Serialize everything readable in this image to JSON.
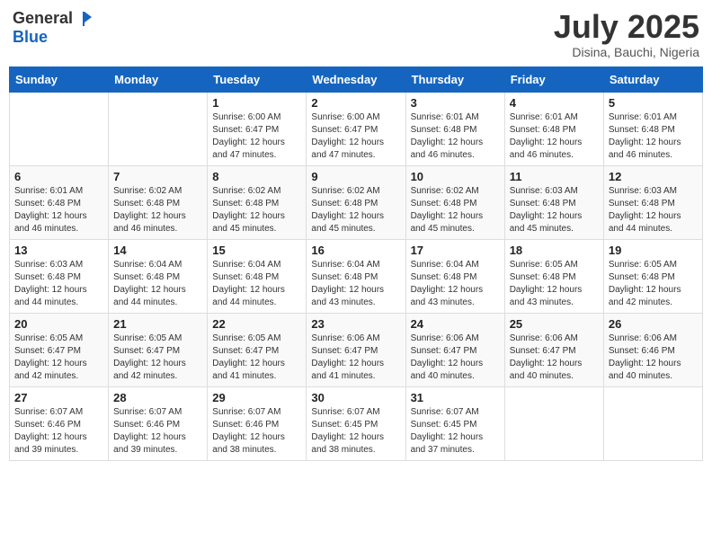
{
  "header": {
    "logo_general": "General",
    "logo_blue": "Blue",
    "month_title": "July 2025",
    "subtitle": "Disina, Bauchi, Nigeria"
  },
  "weekdays": [
    "Sunday",
    "Monday",
    "Tuesday",
    "Wednesday",
    "Thursday",
    "Friday",
    "Saturday"
  ],
  "weeks": [
    [
      {
        "day": "",
        "sunrise": "",
        "sunset": "",
        "daylight": ""
      },
      {
        "day": "",
        "sunrise": "",
        "sunset": "",
        "daylight": ""
      },
      {
        "day": "1",
        "sunrise": "Sunrise: 6:00 AM",
        "sunset": "Sunset: 6:47 PM",
        "daylight": "Daylight: 12 hours and 47 minutes."
      },
      {
        "day": "2",
        "sunrise": "Sunrise: 6:00 AM",
        "sunset": "Sunset: 6:47 PM",
        "daylight": "Daylight: 12 hours and 47 minutes."
      },
      {
        "day": "3",
        "sunrise": "Sunrise: 6:01 AM",
        "sunset": "Sunset: 6:48 PM",
        "daylight": "Daylight: 12 hours and 46 minutes."
      },
      {
        "day": "4",
        "sunrise": "Sunrise: 6:01 AM",
        "sunset": "Sunset: 6:48 PM",
        "daylight": "Daylight: 12 hours and 46 minutes."
      },
      {
        "day": "5",
        "sunrise": "Sunrise: 6:01 AM",
        "sunset": "Sunset: 6:48 PM",
        "daylight": "Daylight: 12 hours and 46 minutes."
      }
    ],
    [
      {
        "day": "6",
        "sunrise": "Sunrise: 6:01 AM",
        "sunset": "Sunset: 6:48 PM",
        "daylight": "Daylight: 12 hours and 46 minutes."
      },
      {
        "day": "7",
        "sunrise": "Sunrise: 6:02 AM",
        "sunset": "Sunset: 6:48 PM",
        "daylight": "Daylight: 12 hours and 46 minutes."
      },
      {
        "day": "8",
        "sunrise": "Sunrise: 6:02 AM",
        "sunset": "Sunset: 6:48 PM",
        "daylight": "Daylight: 12 hours and 45 minutes."
      },
      {
        "day": "9",
        "sunrise": "Sunrise: 6:02 AM",
        "sunset": "Sunset: 6:48 PM",
        "daylight": "Daylight: 12 hours and 45 minutes."
      },
      {
        "day": "10",
        "sunrise": "Sunrise: 6:02 AM",
        "sunset": "Sunset: 6:48 PM",
        "daylight": "Daylight: 12 hours and 45 minutes."
      },
      {
        "day": "11",
        "sunrise": "Sunrise: 6:03 AM",
        "sunset": "Sunset: 6:48 PM",
        "daylight": "Daylight: 12 hours and 45 minutes."
      },
      {
        "day": "12",
        "sunrise": "Sunrise: 6:03 AM",
        "sunset": "Sunset: 6:48 PM",
        "daylight": "Daylight: 12 hours and 44 minutes."
      }
    ],
    [
      {
        "day": "13",
        "sunrise": "Sunrise: 6:03 AM",
        "sunset": "Sunset: 6:48 PM",
        "daylight": "Daylight: 12 hours and 44 minutes."
      },
      {
        "day": "14",
        "sunrise": "Sunrise: 6:04 AM",
        "sunset": "Sunset: 6:48 PM",
        "daylight": "Daylight: 12 hours and 44 minutes."
      },
      {
        "day": "15",
        "sunrise": "Sunrise: 6:04 AM",
        "sunset": "Sunset: 6:48 PM",
        "daylight": "Daylight: 12 hours and 44 minutes."
      },
      {
        "day": "16",
        "sunrise": "Sunrise: 6:04 AM",
        "sunset": "Sunset: 6:48 PM",
        "daylight": "Daylight: 12 hours and 43 minutes."
      },
      {
        "day": "17",
        "sunrise": "Sunrise: 6:04 AM",
        "sunset": "Sunset: 6:48 PM",
        "daylight": "Daylight: 12 hours and 43 minutes."
      },
      {
        "day": "18",
        "sunrise": "Sunrise: 6:05 AM",
        "sunset": "Sunset: 6:48 PM",
        "daylight": "Daylight: 12 hours and 43 minutes."
      },
      {
        "day": "19",
        "sunrise": "Sunrise: 6:05 AM",
        "sunset": "Sunset: 6:48 PM",
        "daylight": "Daylight: 12 hours and 42 minutes."
      }
    ],
    [
      {
        "day": "20",
        "sunrise": "Sunrise: 6:05 AM",
        "sunset": "Sunset: 6:47 PM",
        "daylight": "Daylight: 12 hours and 42 minutes."
      },
      {
        "day": "21",
        "sunrise": "Sunrise: 6:05 AM",
        "sunset": "Sunset: 6:47 PM",
        "daylight": "Daylight: 12 hours and 42 minutes."
      },
      {
        "day": "22",
        "sunrise": "Sunrise: 6:05 AM",
        "sunset": "Sunset: 6:47 PM",
        "daylight": "Daylight: 12 hours and 41 minutes."
      },
      {
        "day": "23",
        "sunrise": "Sunrise: 6:06 AM",
        "sunset": "Sunset: 6:47 PM",
        "daylight": "Daylight: 12 hours and 41 minutes."
      },
      {
        "day": "24",
        "sunrise": "Sunrise: 6:06 AM",
        "sunset": "Sunset: 6:47 PM",
        "daylight": "Daylight: 12 hours and 40 minutes."
      },
      {
        "day": "25",
        "sunrise": "Sunrise: 6:06 AM",
        "sunset": "Sunset: 6:47 PM",
        "daylight": "Daylight: 12 hours and 40 minutes."
      },
      {
        "day": "26",
        "sunrise": "Sunrise: 6:06 AM",
        "sunset": "Sunset: 6:46 PM",
        "daylight": "Daylight: 12 hours and 40 minutes."
      }
    ],
    [
      {
        "day": "27",
        "sunrise": "Sunrise: 6:07 AM",
        "sunset": "Sunset: 6:46 PM",
        "daylight": "Daylight: 12 hours and 39 minutes."
      },
      {
        "day": "28",
        "sunrise": "Sunrise: 6:07 AM",
        "sunset": "Sunset: 6:46 PM",
        "daylight": "Daylight: 12 hours and 39 minutes."
      },
      {
        "day": "29",
        "sunrise": "Sunrise: 6:07 AM",
        "sunset": "Sunset: 6:46 PM",
        "daylight": "Daylight: 12 hours and 38 minutes."
      },
      {
        "day": "30",
        "sunrise": "Sunrise: 6:07 AM",
        "sunset": "Sunset: 6:45 PM",
        "daylight": "Daylight: 12 hours and 38 minutes."
      },
      {
        "day": "31",
        "sunrise": "Sunrise: 6:07 AM",
        "sunset": "Sunset: 6:45 PM",
        "daylight": "Daylight: 12 hours and 37 minutes."
      },
      {
        "day": "",
        "sunrise": "",
        "sunset": "",
        "daylight": ""
      },
      {
        "day": "",
        "sunrise": "",
        "sunset": "",
        "daylight": ""
      }
    ]
  ]
}
